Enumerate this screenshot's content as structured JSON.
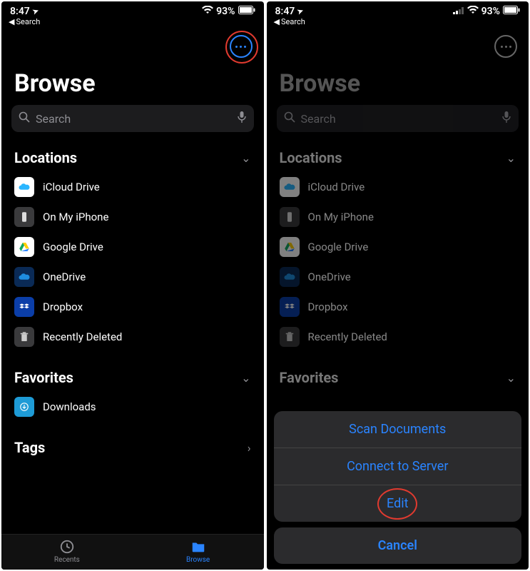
{
  "status": {
    "time": "8:47",
    "location_glyph": "➤",
    "back_label": "Search",
    "signal_label": "signal",
    "wifi_glyph": "📶",
    "battery_pct": "93%"
  },
  "title": "Browse",
  "search": {
    "placeholder": "Search"
  },
  "sections": {
    "locations": {
      "label": "Locations",
      "items": [
        {
          "label": "iCloud Drive",
          "icon": "icloud"
        },
        {
          "label": "On My iPhone",
          "icon": "iphone"
        },
        {
          "label": "Google Drive",
          "icon": "gdrive"
        },
        {
          "label": "OneDrive",
          "icon": "onedrive"
        },
        {
          "label": "Dropbox",
          "icon": "dropbox"
        },
        {
          "label": "Recently Deleted",
          "icon": "trash"
        }
      ]
    },
    "favorites": {
      "label": "Favorites",
      "items": [
        {
          "label": "Downloads",
          "icon": "downloads"
        }
      ]
    },
    "tags": {
      "label": "Tags"
    }
  },
  "tabbar": {
    "recents": "Recents",
    "browse": "Browse"
  },
  "sheet": {
    "scan": "Scan Documents",
    "connect": "Connect to Server",
    "edit": "Edit",
    "cancel": "Cancel"
  }
}
